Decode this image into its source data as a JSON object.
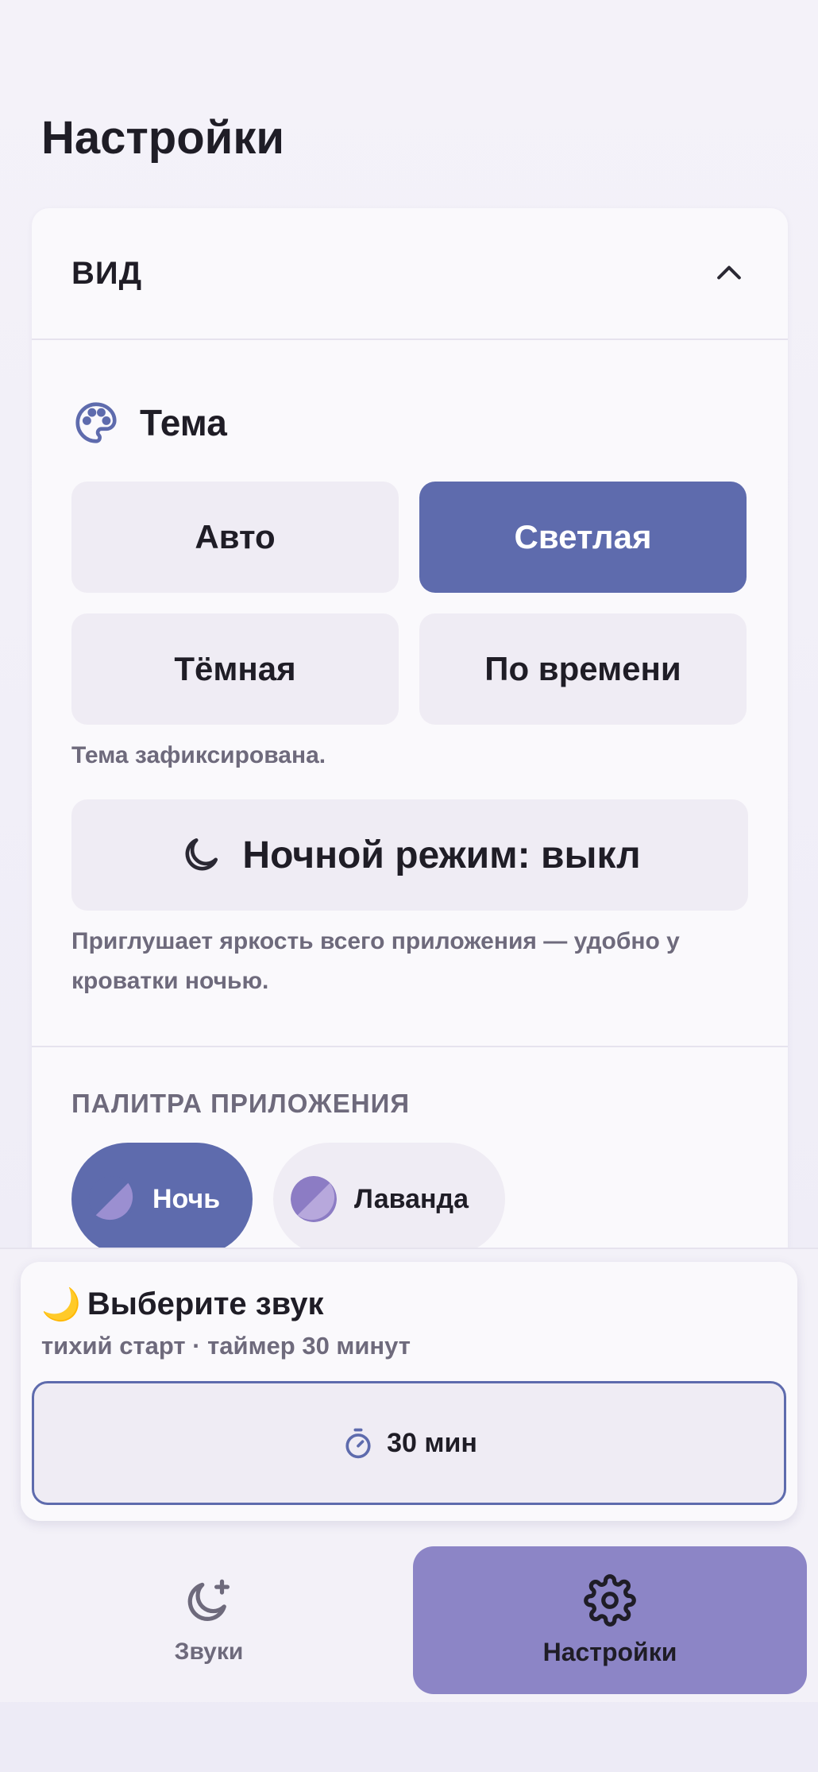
{
  "page": {
    "title": "Настройки"
  },
  "section": {
    "title": "ВИД",
    "theme": {
      "label": "Тема",
      "options": [
        "Авто",
        "Светлая",
        "Тёмная",
        "По времени"
      ],
      "selected": "Светлая",
      "hint": "Тема зафиксирована."
    },
    "night_mode": {
      "label": "Ночной режим: выкл",
      "hint": "Приглушает яркость всего приложения — удобно у кроватки ночью."
    },
    "palette": {
      "label": "ПАЛИТРА ПРИЛОЖЕНИЯ",
      "options": [
        "Ночь",
        "Лаванда"
      ],
      "selected": "Ночь"
    }
  },
  "player": {
    "emoji": "🌙",
    "title": "Выберите звук",
    "subtitle": "тихий старт · таймер 30 минут",
    "timer_label": "30 мин"
  },
  "nav": {
    "sounds": "Звуки",
    "settings": "Настройки",
    "active": "settings"
  },
  "colors": {
    "accent": "#5e6bad",
    "nav_active": "#8c85c6",
    "surface": "#faf9fc",
    "chip_bg": "#efecf4",
    "muted_text": "#6e6a7c"
  },
  "icons": [
    "palette-icon",
    "chevron-up-icon",
    "moon-icon",
    "stopwatch-icon",
    "moon-plus-icon",
    "gear-icon"
  ]
}
